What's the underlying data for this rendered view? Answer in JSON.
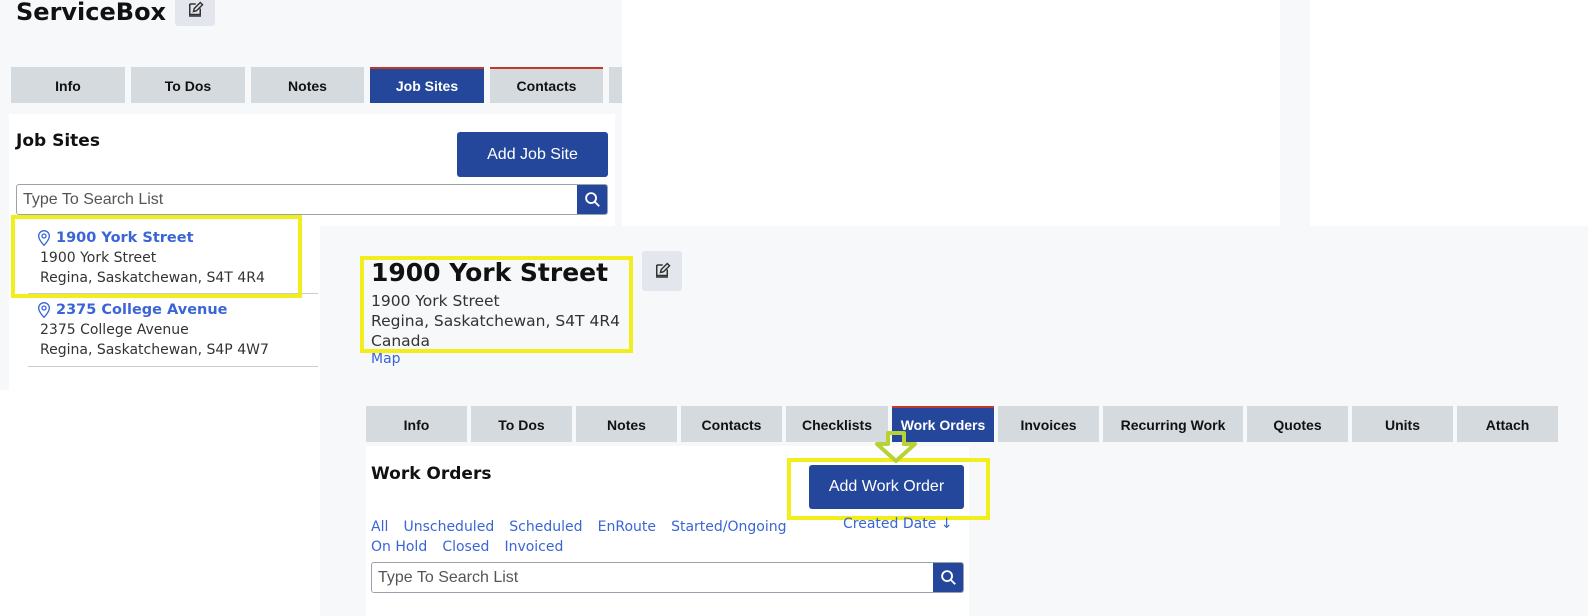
{
  "top": {
    "title": "ServiceBox",
    "tabs": [
      "Info",
      "To Dos",
      "Notes",
      "Job Sites",
      "Contacts"
    ],
    "active_tab": "Job Sites",
    "section_title": "Job Sites",
    "add_button": "Add Job Site",
    "search_placeholder": "Type To Search List",
    "sites": [
      {
        "name": "1900 York Street",
        "street": "1900 York Street",
        "city": "Regina, Saskatchewan, S4T 4R4"
      },
      {
        "name": "2375 College Avenue",
        "street": "2375 College Avenue",
        "city": "Regina, Saskatchewan, S4P 4W7"
      }
    ]
  },
  "bottom": {
    "title": "1900 York Street",
    "street": "1900 York Street",
    "city": "Regina, Saskatchewan, S4T 4R4",
    "country": "Canada",
    "map_link": "Map",
    "tabs": [
      "Info",
      "To Dos",
      "Notes",
      "Contacts",
      "Checklists",
      "Work Orders",
      "Invoices",
      "Recurring Work",
      "Quotes",
      "Units",
      "Attach"
    ],
    "active_tab": "Work Orders",
    "section_title": "Work Orders",
    "add_button": "Add Work Order",
    "filters_row1": [
      "All",
      "Unscheduled",
      "Scheduled",
      "EnRoute",
      "Started/Ongoing"
    ],
    "filters_row2": [
      "On Hold",
      "Closed",
      "Invoiced"
    ],
    "sort_label": "Created Date",
    "sort_icon": "arrow-down-icon",
    "search_placeholder": "Type To Search List"
  },
  "colors": {
    "primary": "#25479b",
    "link": "#3a65d6",
    "highlight": "#f2ee1c",
    "arrow": "#b5d335",
    "tab_inactive": "#d5dade"
  }
}
